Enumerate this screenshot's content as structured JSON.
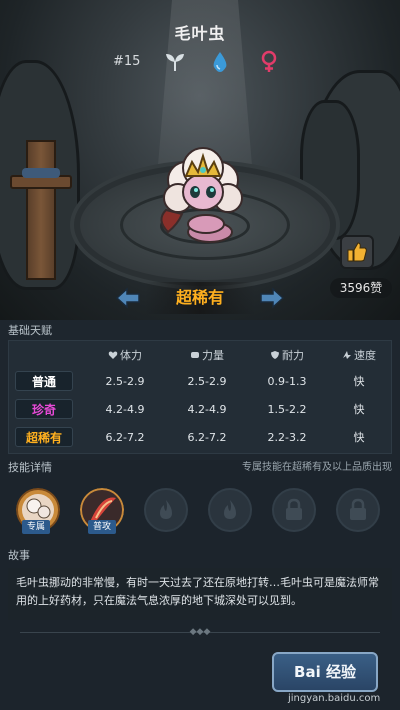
{
  "header": {
    "name": "毛叶虫",
    "number": "#15",
    "type_icon": "leaf-icon",
    "element_icon": "water-drop-icon",
    "gender_icon": "female-icon"
  },
  "scene": {
    "like_count": "3596赞",
    "rarity": "超稀有"
  },
  "talents": {
    "section_title": "基础天赋",
    "headers": [
      "体力",
      "力量",
      "耐力",
      "速度"
    ],
    "rows": [
      {
        "rank": "普通",
        "color": "#ffffff",
        "hp": "2.5-2.9",
        "power": "2.5-2.9",
        "endurance": "0.9-1.3",
        "speed": "快"
      },
      {
        "rank": "珍奇",
        "color": "#e84ad8",
        "hp": "4.2-4.9",
        "power": "4.2-4.9",
        "endurance": "1.5-2.2",
        "speed": "快"
      },
      {
        "rank": "超稀有",
        "color": "#ffb01f",
        "hp": "6.2-7.2",
        "power": "6.2-7.2",
        "endurance": "2.2-3.2",
        "speed": "快"
      }
    ]
  },
  "skills": {
    "section_title": "技能详情",
    "note": "专属技能在超稀有及以上品质出现",
    "slot1_tag": "专属",
    "slot2_tag": "普攻"
  },
  "story": {
    "section_title": "故事",
    "text": "毛叶虫挪动的非常慢，有时一天过去了还在原地打转…毛叶虫可是魔法师常用的上好药材，只在魔法气息浓厚的地下城深处可以见到。"
  },
  "watermark": {
    "button": "Bai 经验",
    "url": "jingyan.baidu.com"
  },
  "colors": {
    "rarity_gold": "#ffb01f",
    "rare_pink": "#e84ad8",
    "accent_blue": "#3b9ad9"
  }
}
